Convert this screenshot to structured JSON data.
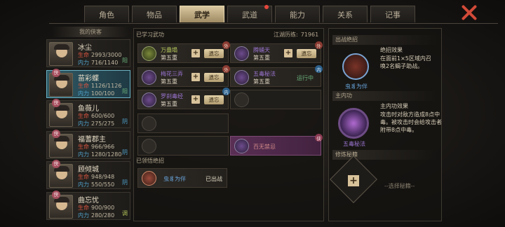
{
  "tabs": [
    {
      "label": "角色",
      "active": false,
      "dot": false
    },
    {
      "label": "物品",
      "active": false,
      "dot": false
    },
    {
      "label": "武学",
      "active": true,
      "dot": false
    },
    {
      "label": "武道",
      "active": false,
      "dot": true
    },
    {
      "label": "能力",
      "active": false,
      "dot": false
    },
    {
      "label": "关系",
      "active": false,
      "dot": false
    },
    {
      "label": "记事",
      "active": false,
      "dot": false
    }
  ],
  "roster": {
    "header": "我的侠客",
    "characters": [
      {
        "name": "冰尘",
        "hp": "2993/3000",
        "mp": "716/1140",
        "side": "阳",
        "badge": "",
        "selected": false
      },
      {
        "name": "苗彩蝶",
        "hp": "1126/1126",
        "mp": "100/100",
        "side": "阳",
        "badge": "侠",
        "selected": true
      },
      {
        "name": "鱼薇儿",
        "hp": "600/600",
        "mp": "275/275",
        "side": "阴",
        "badge": "侠",
        "selected": false
      },
      {
        "name": "福蓍郡主",
        "hp": "966/966",
        "mp": "1280/1280",
        "side": "阴",
        "badge": "侠",
        "selected": false
      },
      {
        "name": "顾倾城",
        "hp": "948/948",
        "mp": "550/550",
        "side": "阴",
        "badge": "侠",
        "selected": false
      },
      {
        "name": "曲忘忧",
        "hp": "900/900",
        "mp": "280/280",
        "side": "调",
        "badge": "侠",
        "selected": false
      }
    ],
    "hp_label": "生命",
    "mp_label": "内力"
  },
  "learned": {
    "header": "已学习武功",
    "jianghu_label": "江湖历练:",
    "jianghu_value": "71961",
    "skills": [
      {
        "name": "万蠱塌",
        "level": "第五重",
        "action": "遗忘",
        "corner": "外",
        "style": "g"
      },
      {
        "name": "腾蛹天",
        "level": "第五重",
        "action": "遗忘",
        "corner": "外",
        "style": "p"
      },
      {
        "name": "梅花三弄",
        "level": "第五重",
        "action": "遗忘",
        "corner": "外",
        "style": "p"
      },
      {
        "name": "五毒秘法",
        "level": "第五重",
        "action": "运行中",
        "corner": "内",
        "style": "p"
      },
      {
        "name": "罗刹毒经",
        "level": "第五重",
        "action": "遗忘",
        "corner": "内",
        "style": "p"
      },
      {
        "name": "",
        "level": "",
        "action": "",
        "corner": "",
        "style": "e"
      },
      {
        "name": "",
        "level": "",
        "action": "",
        "corner": "",
        "style": "e"
      },
      {
        "name": "百无禁忌",
        "level": "",
        "action": "",
        "corner": "侠",
        "style": "x"
      },
      {
        "name": "",
        "level": "",
        "action": "",
        "corner": "",
        "style": "e"
      }
    ]
  },
  "comprehended": {
    "header": "已领悟绝招",
    "name": "虫豸为伴",
    "status": "已出战"
  },
  "right": {
    "ultimate_header": "出战绝招",
    "ultimate_desc_title": "绝招效果",
    "ultimate_desc": "在面前1×5区域内召唤2名蝎子助战。",
    "ultimate_name": "虫豸为伴",
    "inner_header": "主内功",
    "inner_desc_title": "主内功效果",
    "inner_desc": "攻击时对敌方造成8点中毒。被攻击时会给攻击者附带8点中毒。",
    "inner_name": "五毒秘法",
    "practice_header": "修炼秘籍",
    "practice_choose": "--选择秘籍--"
  },
  "colors": {
    "accent": "#d8c29a",
    "hp": "#d3533f",
    "mp": "#4fa0c8",
    "purple": "#9a74d0",
    "blue": "#6aa8e0",
    "close": "#d24a38"
  }
}
